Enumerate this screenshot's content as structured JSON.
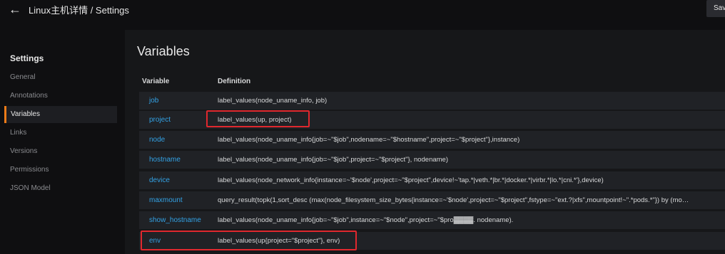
{
  "header": {
    "back_icon": "arrow-left-icon",
    "breadcrumb": "Linux主机详情 / Settings",
    "save_label": "Sav"
  },
  "sidebar": {
    "title": "Settings",
    "items": [
      {
        "label": "General",
        "active": false
      },
      {
        "label": "Annotations",
        "active": false
      },
      {
        "label": "Variables",
        "active": true
      },
      {
        "label": "Links",
        "active": false
      },
      {
        "label": "Versions",
        "active": false
      },
      {
        "label": "Permissions",
        "active": false
      },
      {
        "label": "JSON Model",
        "active": false
      }
    ]
  },
  "main": {
    "title": "Variables",
    "columns": {
      "variable": "Variable",
      "definition": "Definition"
    },
    "rows": [
      {
        "name": "job",
        "definition": "label_values(node_uname_info, job)"
      },
      {
        "name": "project",
        "definition": "label_values(up, project)"
      },
      {
        "name": "node",
        "definition": "label_values(node_uname_info{job=~\"$job\",nodename=~\"$hostname\",project=~\"$project\"},instance)"
      },
      {
        "name": "hostname",
        "definition": "label_values(node_uname_info{job=~\"$job\",project=~\"$project\"}, nodename)"
      },
      {
        "name": "device",
        "definition": "label_values(node_network_info{instance=~'$node',project=~\"$project\",device!~'tap.*|veth.*|br.*|docker.*|virbr.*|lo.*|cni.*'},device)"
      },
      {
        "name": "maxmount",
        "definition": "query_result(topk(1,sort_desc (max(node_filesystem_size_bytes{instance=~'$node',project=~\"$project\",fstype=~\"ext.?|xfs\",mountpoint!~\".*pods.*\"}) by (mo…"
      },
      {
        "name": "show_hostname",
        "definition": "label_values(node_uname_info{job=~\"$job\",instance=~\"$node\",project=~\"$pro▓▓▓▓. nodename)."
      },
      {
        "name": "env",
        "definition": "label_values(up{project=\"$project\"}, env)"
      }
    ]
  },
  "colors": {
    "accent": "#eb7b18",
    "link": "#33a2e5",
    "highlight": "#e0282e"
  }
}
